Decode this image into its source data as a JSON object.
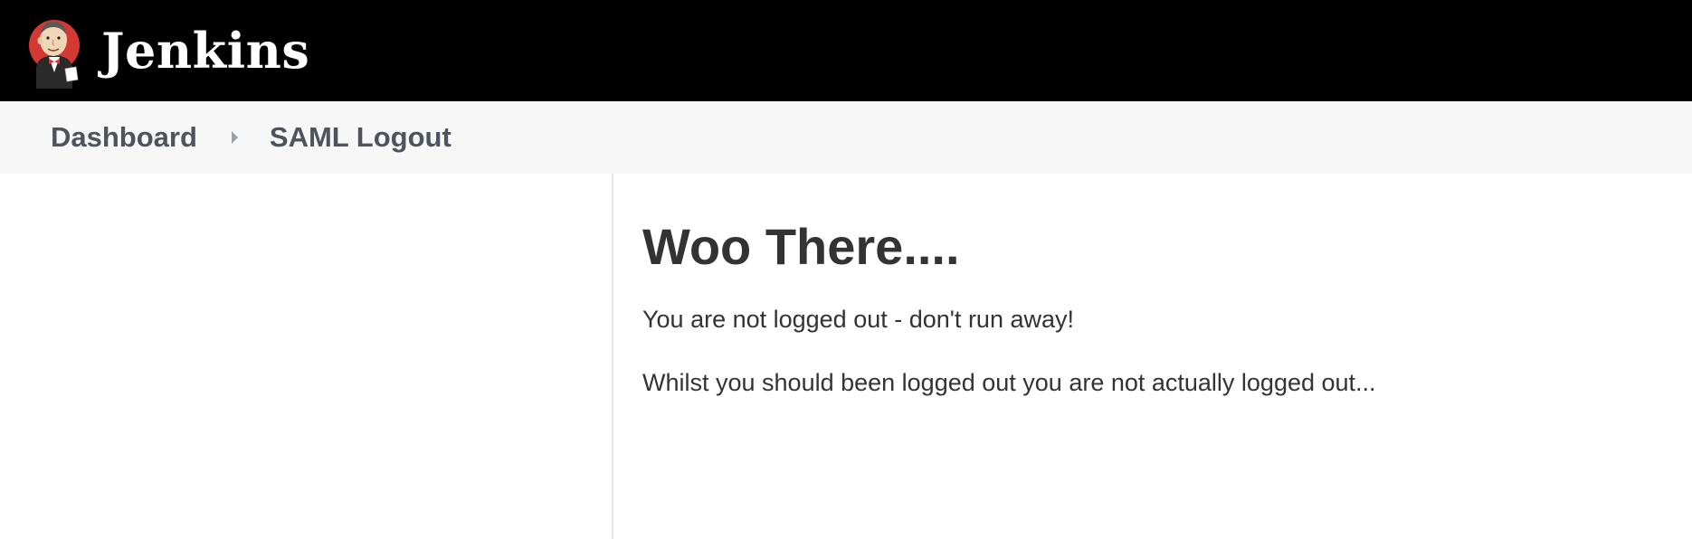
{
  "header": {
    "app_name": "Jenkins",
    "logo_icon": "jenkins-butler-icon"
  },
  "breadcrumb": {
    "items": [
      {
        "label": "Dashboard"
      },
      {
        "label": "SAML Logout"
      }
    ],
    "separator_icon": "chevron-right-icon"
  },
  "main": {
    "title": "Woo There....",
    "paragraphs": [
      "You are not logged out - don't run away!",
      "Whilst you should been logged out you are not actually logged out..."
    ]
  },
  "colors": {
    "header_bg": "#000000",
    "breadcrumb_bg": "#f7f7f7",
    "breadcrumb_text": "#4d545d",
    "body_text": "#333333"
  }
}
